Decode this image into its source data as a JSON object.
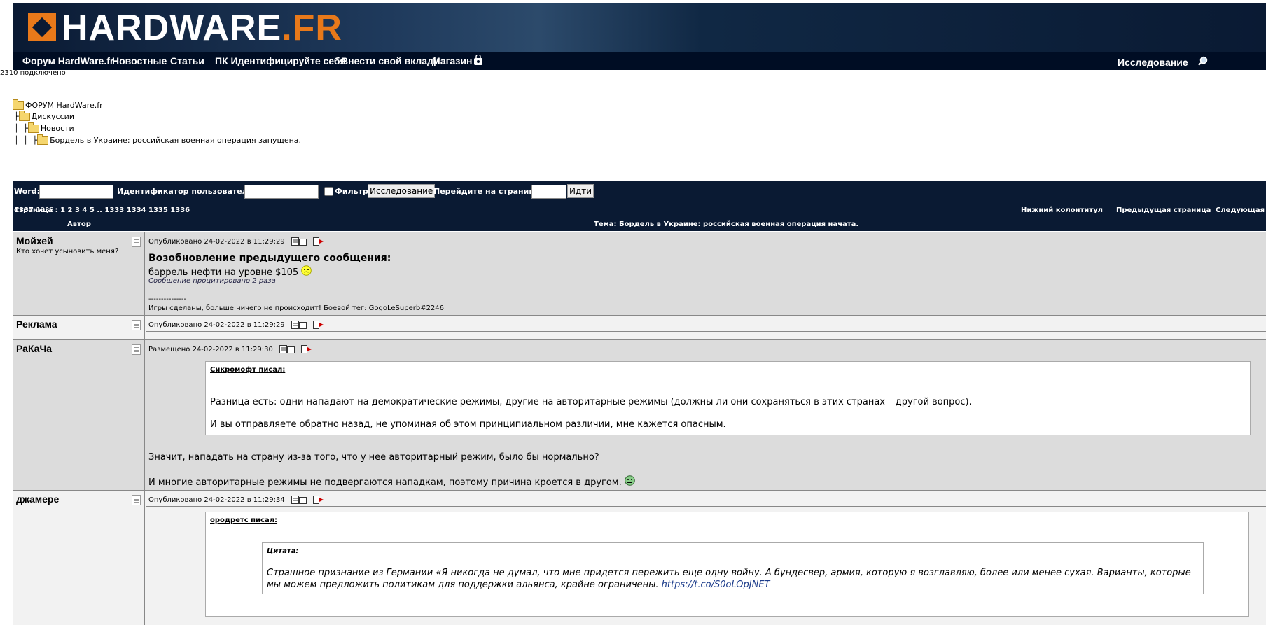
{
  "header": {
    "logo_main": "HARDWARE",
    "logo_tld": ".FR",
    "nav": [
      "Форум HardWare.fr",
      "Новостные",
      "Статьи",
      "ПК Идентифицируйте себя",
      "Внести свой вклад|",
      "Магазин"
    ],
    "search_label": "Исследование",
    "colors": {
      "banner_dark": "#0a1a33",
      "accent_orange": "#e8791a"
    }
  },
  "connected": "2310 подключено",
  "breadcrumb": {
    "root": "ФОРУМ HardWare.fr",
    "level1": "Дискуссии",
    "level2": "Новости",
    "level3": "Бордель в Украине: российская военная операция запущена."
  },
  "searchbar": {
    "word_label": "Word:",
    "user_label": "Идентификатор пользователя:",
    "filter_label": "Фильтр",
    "search_button": "Исследование",
    "goto_label": "Перейдите на страницу:",
    "go_button": "Идти"
  },
  "pagination": {
    "text": "Страница : 1 2 3 4 5 .. 1333 1334 1335 1336",
    "current": "1337",
    "last": "1338",
    "footer": "Нижний колонтитул",
    "prev": "Предыдущая страница",
    "next": "Следующая"
  },
  "table": {
    "author_header": "Автор",
    "topic_header": "Тема: Бордель в Украине: российская военная операция начата."
  },
  "posts": [
    {
      "author": "Мойхей",
      "subtitle": "Кто хочет усыновить меня?",
      "posted": "Опубликовано 24-02-2022 в 11:29:29",
      "title": "Возобновление предыдущего сообщения:",
      "line1": "баррель нефти на уровне $105",
      "quoted": "Сообщение процитировано 2 раза",
      "sig_sep": "---------------",
      "signature": "Игры сделаны, больше ничего не происходит! Боевой тег: GogoLeSuperb#2246"
    },
    {
      "author": "Реклама",
      "posted": "Опубликовано 24-02-2022 в 11:29:29"
    },
    {
      "author": "РаКаЧа",
      "posted": "Размещено 24-02-2022 в 11:29:30",
      "quote_author": "Сикромофт писал:",
      "quote_p1": "Разница есть: одни нападают на демократические режимы, другие на авторитарные режимы (должны ли они сохраняться в этих странах – другой вопрос).",
      "quote_p2": "И вы отправляете обратно назад, не упоминая об этом принципиальном различии, мне кажется опасным.",
      "reply1": "Значит, нападать на страну из-за того, что у нее авторитарный режим, было бы нормально?",
      "reply2": "И многие авторитарные режимы не подвергаются нападкам, поэтому причина кроется в другом."
    },
    {
      "author": "джамере",
      "posted": "Опубликовано 24-02-2022 в 11:29:34",
      "quote_author": "ородретс писал:",
      "inner_label": "Цитата:",
      "inner_line1": "Страшное признание из Германии «Я никогда не думал, что мне придется пережить еще одну войну. А бундесвер, армия, которую я возглавляю, более или менее сухая. Варианты, которые",
      "inner_line2": "мы можем предложить политикам для поддержки альянса, крайне ограничены.",
      "inner_link": "https://t.co/S0oLOpJNET"
    }
  ]
}
